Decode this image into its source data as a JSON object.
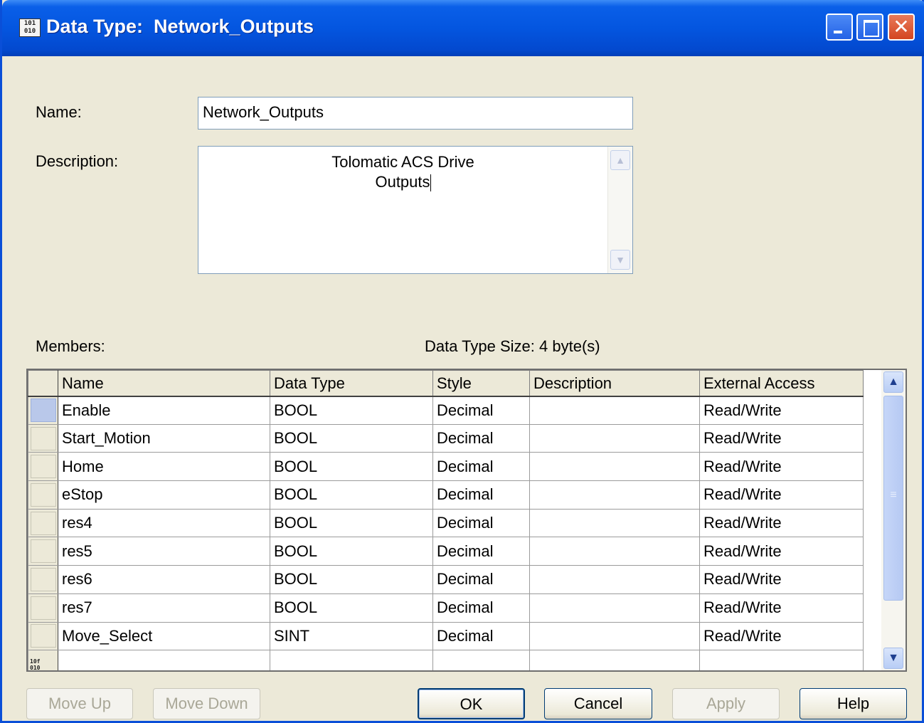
{
  "window": {
    "title": "Data Type:  Network_Outputs",
    "icon_text": "101\n010"
  },
  "form": {
    "name_label": "Name:",
    "name_value": "Network_Outputs",
    "description_label": "Description:",
    "description_line1": "Tolomatic ACS Drive",
    "description_line2": "Outputs"
  },
  "members": {
    "label": "Members:",
    "size_text": "Data Type Size: 4 byte(s)",
    "columns": [
      "Name",
      "Data Type",
      "Style",
      "Description",
      "External Access"
    ],
    "rows": [
      {
        "name": "Enable",
        "data_type": "BOOL",
        "style": "Decimal",
        "description": "",
        "access": "Read/Write"
      },
      {
        "name": "Start_Motion",
        "data_type": "BOOL",
        "style": "Decimal",
        "description": "",
        "access": "Read/Write"
      },
      {
        "name": "Home",
        "data_type": "BOOL",
        "style": "Decimal",
        "description": "",
        "access": "Read/Write"
      },
      {
        "name": "eStop",
        "data_type": "BOOL",
        "style": "Decimal",
        "description": "",
        "access": "Read/Write"
      },
      {
        "name": "res4",
        "data_type": "BOOL",
        "style": "Decimal",
        "description": "",
        "access": "Read/Write"
      },
      {
        "name": "res5",
        "data_type": "BOOL",
        "style": "Decimal",
        "description": "",
        "access": "Read/Write"
      },
      {
        "name": "res6",
        "data_type": "BOOL",
        "style": "Decimal",
        "description": "",
        "access": "Read/Write"
      },
      {
        "name": "res7",
        "data_type": "BOOL",
        "style": "Decimal",
        "description": "",
        "access": "Read/Write"
      },
      {
        "name": "Move_Select",
        "data_type": "SINT",
        "style": "Decimal",
        "description": "",
        "access": "Read/Write"
      }
    ],
    "new_row_icon": "10f\n010"
  },
  "buttons": {
    "move_up": "Move Up",
    "move_down": "Move Down",
    "ok": "OK",
    "cancel": "Cancel",
    "apply": "Apply",
    "help": "Help"
  }
}
